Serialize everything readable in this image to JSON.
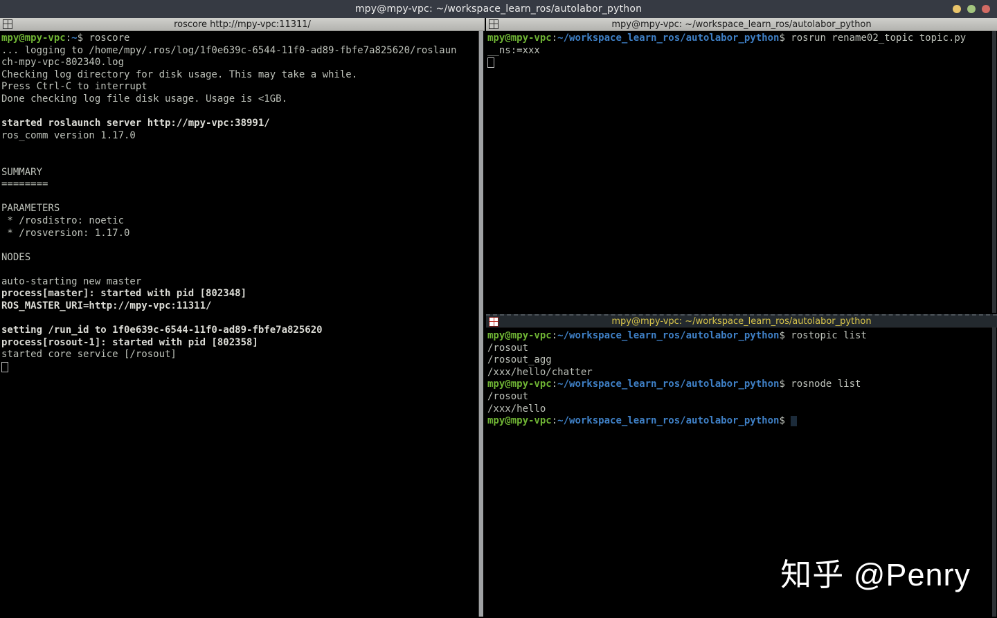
{
  "window": {
    "title": "mpy@mpy-vpc: ~/workspace_learn_ros/autolabor_python",
    "controls": [
      {
        "name": "minimize",
        "color": "#e9c46a"
      },
      {
        "name": "maximize",
        "color": "#a3c57f"
      },
      {
        "name": "close",
        "color": "#d26b64"
      }
    ]
  },
  "colors": {
    "window_bar": "#363a43",
    "pane_titlebar_bg": "#c4c4c0",
    "pane_titlebar_fg": "#1d1d1d",
    "focused_titlebar_bg": "#23292e",
    "focused_titlebar_fg": "#d9c54b",
    "terminal_bg": "#000000",
    "terminal_fg": "#bec2ba",
    "terminal_bold_fg": "#dcdcd6",
    "prompt_green": "#6fb434",
    "path_blue": "#3f80c6"
  },
  "panes": [
    {
      "id": "roscore",
      "title": "roscore http://mpy-vpc:11311/",
      "focused": false,
      "lines": [
        [
          {
            "t": "mpy@mpy-vpc",
            "c": "green",
            "b": true
          },
          {
            "t": ":"
          },
          {
            "t": "~",
            "c": "blue",
            "b": true
          },
          {
            "t": "$ roscore"
          }
        ],
        [
          {
            "t": "... logging to /home/mpy/.ros/log/1f0e639c-6544-11f0-ad89-fbfe7a825620/roslaun"
          }
        ],
        [
          {
            "t": "ch-mpy-vpc-802340.log"
          }
        ],
        [
          {
            "t": "Checking log directory for disk usage. This may take a while."
          }
        ],
        [
          {
            "t": "Press Ctrl-C to interrupt"
          }
        ],
        [
          {
            "t": "Done checking log file disk usage. Usage is <1GB."
          }
        ],
        [],
        [
          {
            "t": "started roslaunch server http://mpy-vpc:38991/",
            "b": true
          }
        ],
        [
          {
            "t": "ros_comm version 1.17.0"
          }
        ],
        [],
        [],
        [
          {
            "t": "SUMMARY"
          }
        ],
        [
          {
            "t": "========"
          }
        ],
        [],
        [
          {
            "t": "PARAMETERS"
          }
        ],
        [
          {
            "t": " * /rosdistro: noetic"
          }
        ],
        [
          {
            "t": " * /rosversion: 1.17.0"
          }
        ],
        [],
        [
          {
            "t": "NODES"
          }
        ],
        [],
        [
          {
            "t": "auto-starting new master"
          }
        ],
        [
          {
            "t": "process[master]: started with pid [802348]",
            "b": true
          }
        ],
        [
          {
            "t": "ROS_MASTER_URI=http://mpy-vpc:11311/",
            "b": true
          }
        ],
        [],
        [
          {
            "t": "setting /run_id to 1f0e639c-6544-11f0-ad89-fbfe7a825620",
            "b": true
          }
        ],
        [
          {
            "t": "process[rosout-1]: started with pid [802358]",
            "b": true
          }
        ],
        [
          {
            "t": "started core service [/rosout]"
          }
        ],
        [
          {
            "cursor": "hollow"
          }
        ]
      ]
    },
    {
      "id": "rosrun",
      "title": "mpy@mpy-vpc: ~/workspace_learn_ros/autolabor_python",
      "focused": false,
      "lines": [
        [
          {
            "t": "mpy@mpy-vpc",
            "c": "green",
            "b": true
          },
          {
            "t": ":"
          },
          {
            "t": "~/workspace_learn_ros/autolabor_python",
            "c": "blue",
            "b": true
          },
          {
            "t": "$ rosrun rename02_topic topic.py"
          }
        ],
        [
          {
            "t": "__ns:=xxx"
          }
        ],
        [
          {
            "cursor": "hollow"
          }
        ]
      ]
    },
    {
      "id": "rostopic",
      "title": "mpy@mpy-vpc: ~/workspace_learn_ros/autolabor_python",
      "focused": true,
      "lines": [
        [
          {
            "t": "mpy@mpy-vpc",
            "c": "green",
            "b": true
          },
          {
            "t": ":"
          },
          {
            "t": "~/workspace_learn_ros/autolabor_python",
            "c": "blue",
            "b": true
          },
          {
            "t": "$ rostopic list"
          }
        ],
        [
          {
            "t": "/rosout"
          }
        ],
        [
          {
            "t": "/rosout_agg"
          }
        ],
        [
          {
            "t": "/xxx/hello/chatter"
          }
        ],
        [
          {
            "t": "mpy@mpy-vpc",
            "c": "green",
            "b": true
          },
          {
            "t": ":"
          },
          {
            "t": "~/workspace_learn_ros/autolabor_python",
            "c": "blue",
            "b": true
          },
          {
            "t": "$ rosnode list"
          }
        ],
        [
          {
            "t": "/rosout"
          }
        ],
        [
          {
            "t": "/xxx/hello"
          }
        ],
        [
          {
            "t": "mpy@mpy-vpc",
            "c": "green",
            "b": true
          },
          {
            "t": ":"
          },
          {
            "t": "~/workspace_learn_ros/autolabor_python",
            "c": "blue",
            "b": true
          },
          {
            "t": "$ "
          },
          {
            "cursor": "block"
          }
        ]
      ]
    }
  ],
  "watermark": "知乎 @Penry"
}
